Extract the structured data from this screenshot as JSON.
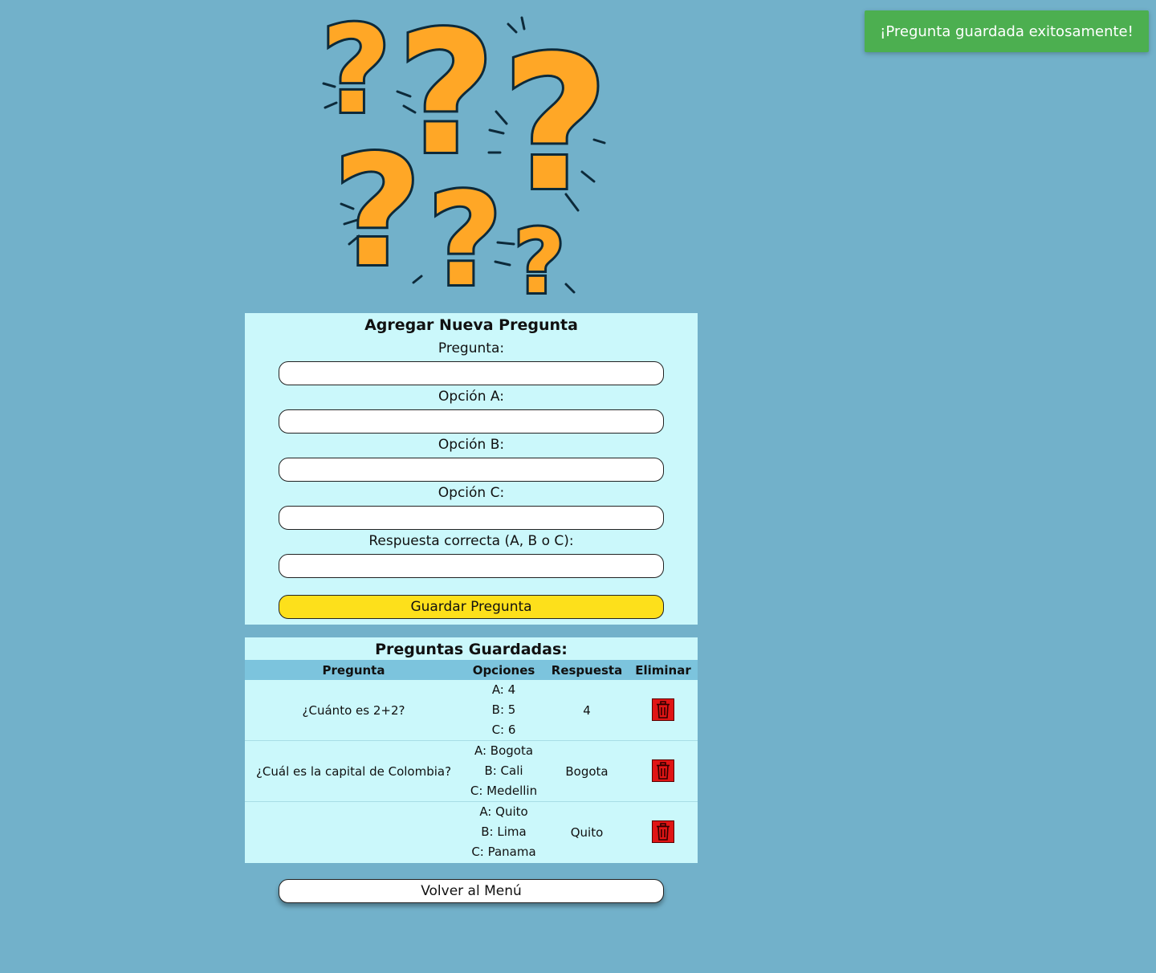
{
  "toast": {
    "message": "¡Pregunta guardada exitosamente!"
  },
  "hero": {
    "icon": "question-marks-illustration",
    "accent": "#ffa726",
    "outline": "#0d2a3a"
  },
  "form": {
    "title": "Agregar Nueva Pregunta",
    "fields": [
      {
        "label": "Pregunta:",
        "value": ""
      },
      {
        "label": "Opción A:",
        "value": ""
      },
      {
        "label": "Opción B:",
        "value": ""
      },
      {
        "label": "Opción C:",
        "value": ""
      },
      {
        "label": "Respuesta correcta (A, B o C):",
        "value": ""
      }
    ],
    "save_label": "Guardar Pregunta"
  },
  "saved": {
    "title": "Preguntas Guardadas:",
    "headers": [
      "Pregunta",
      "Opciones",
      "Respuesta",
      "Eliminar"
    ],
    "rows": [
      {
        "question": "¿Cuánto es 2+2?",
        "options": [
          "A: 4",
          "B: 5",
          "C: 6"
        ],
        "answer": "4",
        "delete_icon": "trash-icon"
      },
      {
        "question": "¿Cuál es la capital de Colombia?",
        "options": [
          "A: Bogota",
          "B: Cali",
          "C: Medellin"
        ],
        "answer": "Bogota",
        "delete_icon": "trash-icon"
      },
      {
        "question": "",
        "options": [
          "A: Quito",
          "B: Lima",
          "C: Panama"
        ],
        "answer": "Quito",
        "delete_icon": "trash-icon"
      }
    ]
  },
  "back_label": "Volver al Menú",
  "colors": {
    "background": "#72b1ca",
    "panel": "#cbf8fb",
    "header_row": "#7cc4dd",
    "save_button": "#fde01b",
    "toast": "#4caf50",
    "delete": "#e01515"
  }
}
